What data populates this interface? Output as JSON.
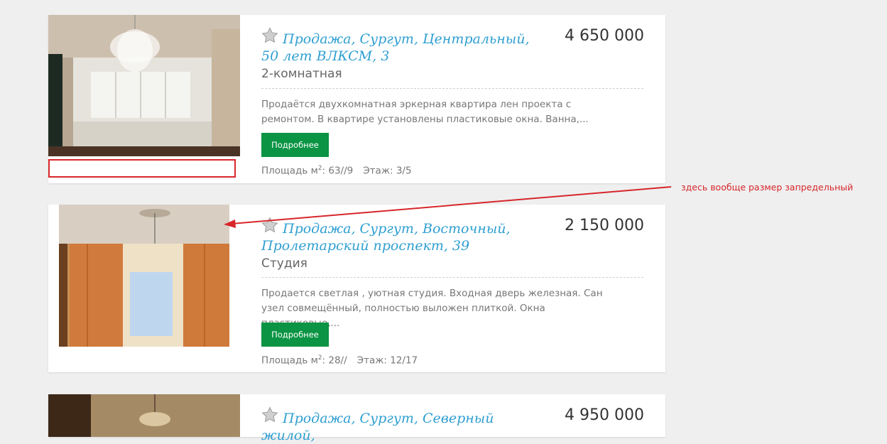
{
  "listings": [
    {
      "title": "Продажа, Сургут, Центральный, 50 лет ВЛКСМ, 3",
      "rooms": "2-комнатная",
      "price": "4 650 000",
      "description": "Продаётся двухкомнатная эркерная квартира лен проекта с ремонтом. В квартире установлены пластиковые окна. Ванна,...",
      "button_label": "Подробнее",
      "area_label": "Площадь м",
      "area_sup": "2",
      "area_value": ": 63//9",
      "floor_label": "Этаж: 3/5"
    },
    {
      "title": "Продажа, Сургут, Восточный, Пролетарский проспект, 39",
      "rooms": "Студия",
      "price": "2 150 000",
      "description": "Продается светлая , уютная студия. Входная дверь железная. Сан узел совмещённый, полностью выложен плиткой. Окна пластиковые,...",
      "button_label": "Подробнее",
      "area_label": "Площадь м",
      "area_sup": "2",
      "area_value": ": 28//",
      "floor_label": "Этаж: 12/17"
    },
    {
      "title": "Продажа, Сургут, Северный жилой,",
      "price": "4 950 000"
    }
  ],
  "annotation": {
    "text": "здесь вообще размер запредельный",
    "color": "#d7262b"
  },
  "colors": {
    "link": "#2f9fd1",
    "button": "#0b9444",
    "background": "#efefef"
  },
  "icons": [
    "star-icon",
    "photo-living-room",
    "photo-studio-room",
    "photo-chandelier-room"
  ]
}
